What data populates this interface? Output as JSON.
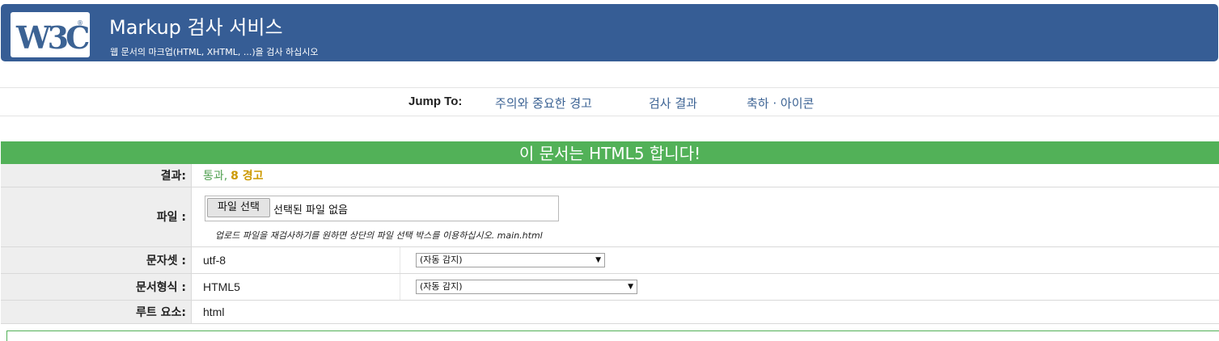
{
  "header": {
    "logo_text": "W3C",
    "title": "Markup 검사 서비스",
    "subtitle": "웹 문서의 마크업(HTML, XHTML, ...)을 검사 하십시오",
    "brand_color": "#365d95"
  },
  "jump": {
    "label": "Jump To:",
    "links": [
      "주의와 중요한 경고",
      "검사 결과",
      "축하 · 아이콘"
    ]
  },
  "result": {
    "headline": "이 문서는 HTML5 합니다!",
    "headline_color": "#52b158",
    "rows": {
      "result": {
        "label": "결과:",
        "pass": "통과,",
        "warnings": "8 경고"
      },
      "file": {
        "label": "파일 :",
        "button": "파일 선택",
        "status": "선택된 파일 없음",
        "hint": "업로드 파일을 재검사하기를 원하면 상단의 파일 선택 박스를 이용하십시오. main.html"
      },
      "charset": {
        "label": "문자셋 :",
        "value": "utf-8",
        "select": "(자동 감지)"
      },
      "doctype": {
        "label": "문서형식 :",
        "value": "HTML5",
        "select": "(자동 감지)"
      },
      "root": {
        "label": "루트 요소:",
        "value": "html"
      }
    }
  }
}
